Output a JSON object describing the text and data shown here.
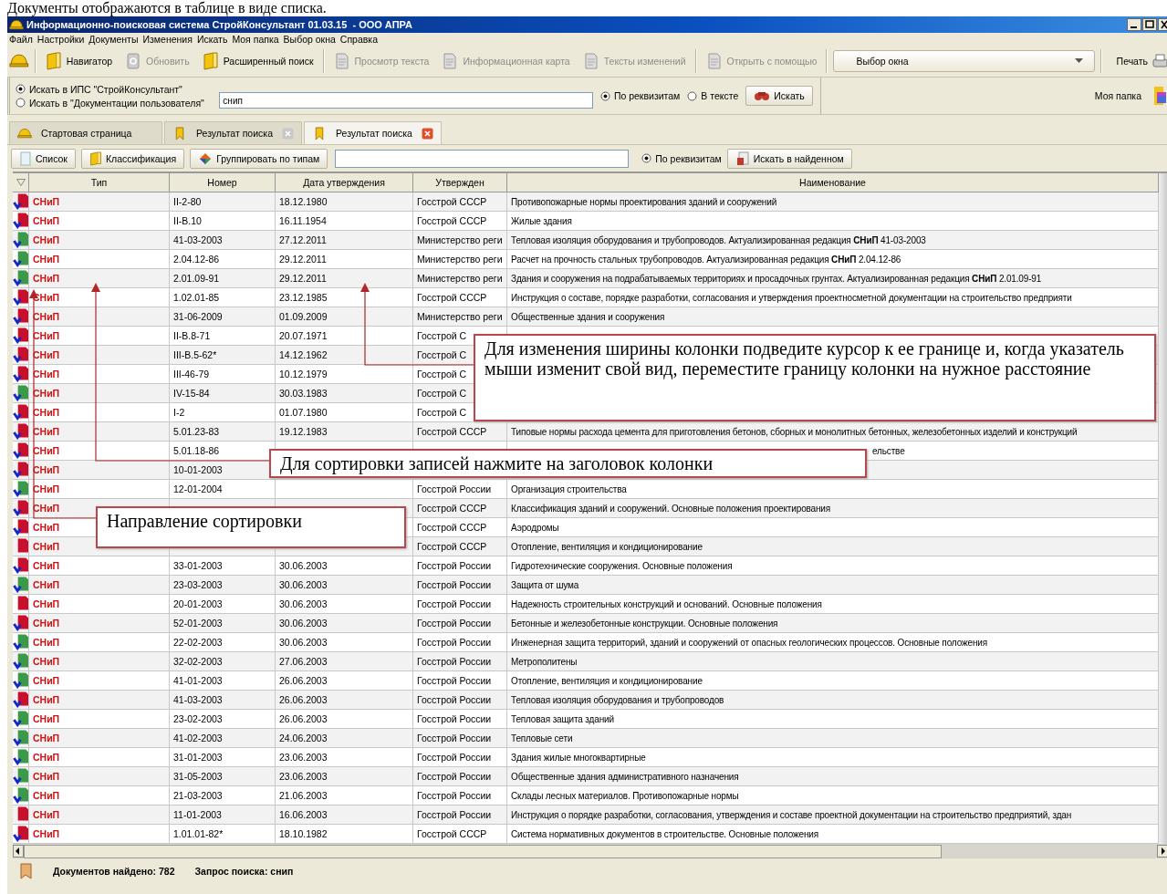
{
  "caption": "Документы отображаются в таблице в виде списка.",
  "window": {
    "title": "Информационно-поисковая система СтройКонсультант 01.03.15  - ООО АПРА"
  },
  "menu": [
    "Файл",
    "Настройки",
    "Документы",
    "Изменения",
    "Искать",
    "Моя папка",
    "Выбор окна",
    "Справка"
  ],
  "toolbar": [
    {
      "label": "Навигатор",
      "disabled": false
    },
    {
      "label": "Обновить",
      "disabled": true
    },
    {
      "label": "Расширенный поиск",
      "disabled": false
    },
    {
      "label": "Просмотр текста",
      "disabled": true
    },
    {
      "label": "Информационная карта",
      "disabled": true
    },
    {
      "label": "Тексты изменений",
      "disabled": true
    },
    {
      "label": "Открыть с помощью",
      "disabled": true
    }
  ],
  "window_select": {
    "value": "Выбор окна"
  },
  "print": {
    "label": "Печать"
  },
  "search": {
    "scopes": [
      {
        "label": "Искать в ИПС \"СтройКонсультант\"",
        "selected": true
      },
      {
        "label": "Искать в \"Документации пользователя\"",
        "selected": false
      }
    ],
    "query": "снип",
    "modes": [
      {
        "label": "По реквизитам",
        "selected": true
      },
      {
        "label": "В тексте",
        "selected": false
      }
    ],
    "button": "Искать"
  },
  "my_folder": "Моя папка",
  "tabs": [
    {
      "label": "Стартовая страница",
      "selected": false,
      "closable": false
    },
    {
      "label": "Результат поиска",
      "selected": false,
      "closable": true
    },
    {
      "label": "Результат поиска",
      "selected": true,
      "closable": true
    }
  ],
  "list_toolbar": {
    "buttons": [
      "Список",
      "Классификация",
      "Группировать по типам"
    ],
    "filter_modes": [
      {
        "label": "По реквизитам",
        "selected": true
      }
    ],
    "search_button": "Искать в найденном"
  },
  "table": {
    "columns": [
      "Тип",
      "Номер",
      "Дата утверждения",
      "Утвержден",
      "Наименование"
    ],
    "rows": [
      {
        "color": "#c8102e",
        "linked": true,
        "type": "СНиП",
        "number": "II-2-80",
        "date": "18.12.1980",
        "approved": "Госстрой СССР",
        "name": "Противопожарные нормы проектирования зданий и сооружений"
      },
      {
        "color": "#c8102e",
        "linked": true,
        "type": "СНиП",
        "number": "II-В.10",
        "date": "16.11.1954",
        "approved": "Госстрой СССР",
        "name": "Жилые здания"
      },
      {
        "color": "#3a9a4a",
        "linked": true,
        "type": "СНиП",
        "number": "41-03-2003",
        "date": "27.12.2011",
        "approved": "Министерство реги",
        "name": "Тепловая изоляция оборудования и трубопроводов. Актуализированная редакция **СНиП** 41-03-2003"
      },
      {
        "color": "#3a9a4a",
        "linked": true,
        "type": "СНиП",
        "number": "2.04.12-86",
        "date": "29.12.2011",
        "approved": "Министерство реги",
        "name": "Расчет на прочность стальных трубопроводов. Актуализированная редакция **СНиП** 2.04.12-86"
      },
      {
        "color": "#3a9a4a",
        "linked": true,
        "type": "СНиП",
        "number": "2.01.09-91",
        "date": "29.12.2011",
        "approved": "Министерство реги",
        "name": "Здания и сооружения на подрабатываемых территориях и просадочных грунтах. Актуализированная редакция **СНиП** 2.01.09-91"
      },
      {
        "color": "#c8102e",
        "linked": true,
        "type": "СНиП",
        "number": "1.02.01-85",
        "date": "23.12.1985",
        "approved": "Госстрой СССР",
        "name": "Инструкция о составе, порядке разработки, согласования и утверждения проектносметной документации на строительство предприяти"
      },
      {
        "color": "#c8102e",
        "linked": true,
        "type": "СНиП",
        "number": "31-06-2009",
        "date": "01.09.2009",
        "approved": "Министерство реги",
        "name": "Общественные здания и сооружения"
      },
      {
        "color": "#c8102e",
        "linked": true,
        "type": "СНиП",
        "number": "II-В.8-71",
        "date": "20.07.1971",
        "approved": "Госстрой С"
      },
      {
        "color": "#c8102e",
        "linked": true,
        "type": "СНиП",
        "number": "III-В.5-62*",
        "date": "14.12.1962",
        "approved": "Госстрой С"
      },
      {
        "color": "#c8102e",
        "linked": true,
        "type": "СНиП",
        "number": "III-46-79",
        "date": "10.12.1979",
        "approved": "Госстрой С"
      },
      {
        "color": "#3a9a4a",
        "linked": true,
        "type": "СНиП",
        "number": "IV-15-84",
        "date": "30.03.1983",
        "approved": "Госстрой С"
      },
      {
        "color": "#c8102e",
        "linked": true,
        "type": "СНиП",
        "number": "I-2",
        "date": "01.07.1980",
        "approved": "Госстрой С"
      },
      {
        "color": "#c8102e",
        "linked": true,
        "type": "СНиП",
        "number": "5.01.23-83",
        "date": "19.12.1983",
        "approved": "Госстрой СССР",
        "name": "Типовые нормы расхода цемента для приготовления бетонов, сборных и монолитных бетонных, железобетонных изделий и конструкций"
      },
      {
        "color": "#c8102e",
        "linked": true,
        "type": "СНиП",
        "number": "5.01.18-86",
        "name": "ельстве"
      },
      {
        "color": "#c8102e",
        "linked": true,
        "type": "СНиП",
        "number": "10-01-2003"
      },
      {
        "color": "#3a9a4a",
        "linked": true,
        "type": "СНиП",
        "number": "12-01-2004",
        "approved": "Госстрой России",
        "name": "Организация строительства"
      },
      {
        "color": "#c8102e",
        "linked": true,
        "type": "СНиП",
        "approved": "Госстрой СССР",
        "name": "Классификация зданий и сооружений. Основные положения проектирования"
      },
      {
        "color": "#c8102e",
        "linked": true,
        "type": "СНиП",
        "approved": "Госстрой СССР",
        "name": "Аэродромы"
      },
      {
        "color": "#c8102e",
        "linked": false,
        "type": "СНиП",
        "approved": "Госстрой СССР",
        "name": "Отопление, вентиляция и кондиционирование"
      },
      {
        "color": "#c8102e",
        "linked": true,
        "type": "СНиП",
        "number": "33-01-2003",
        "date": "30.06.2003",
        "approved": "Госстрой России",
        "name": "Гидротехнические сооружения. Основные положения"
      },
      {
        "color": "#3a9a4a",
        "linked": true,
        "type": "СНиП",
        "number": "23-03-2003",
        "date": "30.06.2003",
        "approved": "Госстрой России",
        "name": "Защита от шума"
      },
      {
        "color": "#c8102e",
        "linked": false,
        "type": "СНиП",
        "number": "20-01-2003",
        "date": "30.06.2003",
        "approved": "Госстрой России",
        "name": "Надежность строительных конструкций и оснований. Основные положения"
      },
      {
        "color": "#c8102e",
        "linked": true,
        "type": "СНиП",
        "number": "52-01-2003",
        "date": "30.06.2003",
        "approved": "Госстрой России",
        "name": "Бетонные и железобетонные конструкции. Основные положения"
      },
      {
        "color": "#3a9a4a",
        "linked": true,
        "type": "СНиП",
        "number": "22-02-2003",
        "date": "30.06.2003",
        "approved": "Госстрой России",
        "name": "Инженерная защита территорий, зданий и сооружений от опасных геологических процессов. Основные положения"
      },
      {
        "color": "#3a9a4a",
        "linked": true,
        "type": "СНиП",
        "number": "32-02-2003",
        "date": "27.06.2003",
        "approved": "Госстрой России",
        "name": "Метрополитены"
      },
      {
        "color": "#3a9a4a",
        "linked": true,
        "type": "СНиП",
        "number": "41-01-2003",
        "date": "26.06.2003",
        "approved": "Госстрой России",
        "name": "Отопление, вентиляция и кондиционирование"
      },
      {
        "color": "#c8102e",
        "linked": true,
        "type": "СНиП",
        "number": "41-03-2003",
        "date": "26.06.2003",
        "approved": "Госстрой России",
        "name": "Тепловая изоляция оборудования и трубопроводов"
      },
      {
        "color": "#3a9a4a",
        "linked": true,
        "type": "СНиП",
        "number": "23-02-2003",
        "date": "26.06.2003",
        "approved": "Госстрой России",
        "name": "Тепловая защита зданий"
      },
      {
        "color": "#3a9a4a",
        "linked": true,
        "type": "СНиП",
        "number": "41-02-2003",
        "date": "24.06.2003",
        "approved": "Госстрой России",
        "name": "Тепловые сети"
      },
      {
        "color": "#3a9a4a",
        "linked": true,
        "type": "СНиП",
        "number": "31-01-2003",
        "date": "23.06.2003",
        "approved": "Госстрой России",
        "name": "Здания жилые многоквартирные"
      },
      {
        "color": "#3a9a4a",
        "linked": true,
        "type": "СНиП",
        "number": "31-05-2003",
        "date": "23.06.2003",
        "approved": "Госстрой России",
        "name": "Общественные здания административного назначения"
      },
      {
        "color": "#3a9a4a",
        "linked": true,
        "type": "СНиП",
        "number": "21-03-2003",
        "date": "21.06.2003",
        "approved": "Госстрой России",
        "name": "Склады лесных материалов. Противопожарные нормы"
      },
      {
        "color": "#c8102e",
        "linked": false,
        "type": "СНиП",
        "number": "11-01-2003",
        "date": "16.06.2003",
        "approved": "Госстрой России",
        "name": "Инструкция о порядке разработки, согласования, утверждения и составе проектной документации на строительство предприятий, здан"
      },
      {
        "color": "#c8102e",
        "linked": true,
        "type": "СНиП",
        "number": "1.01.01-82*",
        "date": "18.10.1982",
        "approved": "Госстрой СССР",
        "name": "Система нормативных документов в строительстве. Основные положения"
      }
    ]
  },
  "callouts": [
    {
      "text": "Для изменения ширины колонки подведите курсор к ее границе и, когда указатель мыши изменит свой вид, переместите границу колонки на нужное расстояние"
    },
    {
      "text": "Для сортировки записей нажмите на заголовок колонки"
    },
    {
      "text": "Направление сортировки"
    }
  ],
  "status_bar": {
    "found": "Документов найдено: 782",
    "query": "Запрос поиска: снип"
  }
}
